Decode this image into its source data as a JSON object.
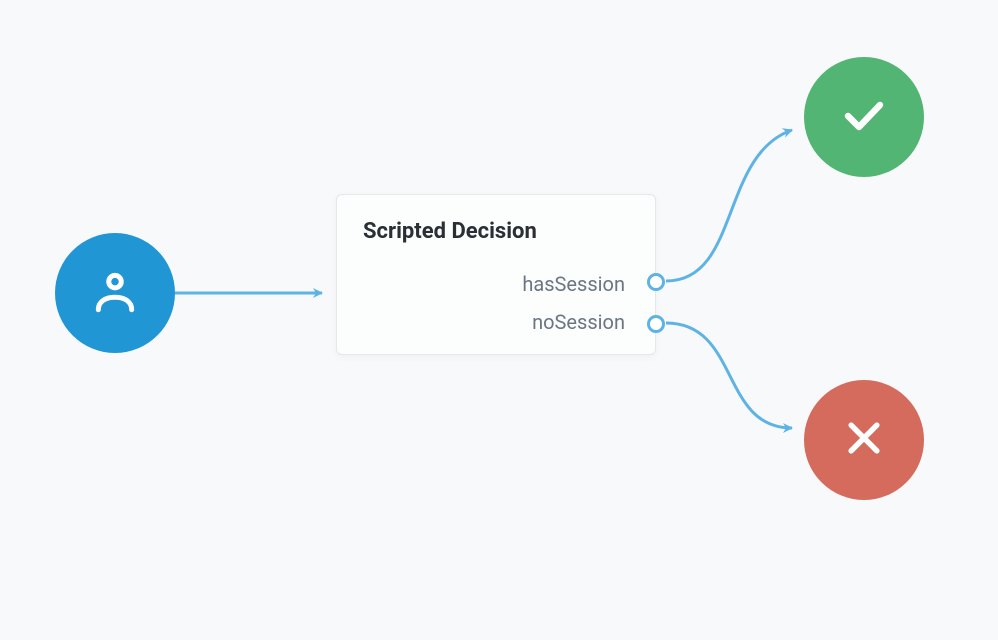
{
  "nodes": {
    "start": {
      "icon": "user-icon"
    },
    "decision": {
      "title": "Scripted Decision",
      "outcomes": [
        "hasSession",
        "noSession"
      ]
    },
    "success": {
      "icon": "check-icon"
    },
    "failure": {
      "icon": "cross-icon"
    }
  },
  "colors": {
    "start": "#2196d5",
    "success": "#53b573",
    "failure": "#d56b5c",
    "connector": "#5eb3e4",
    "background": "#f8f9fa"
  }
}
